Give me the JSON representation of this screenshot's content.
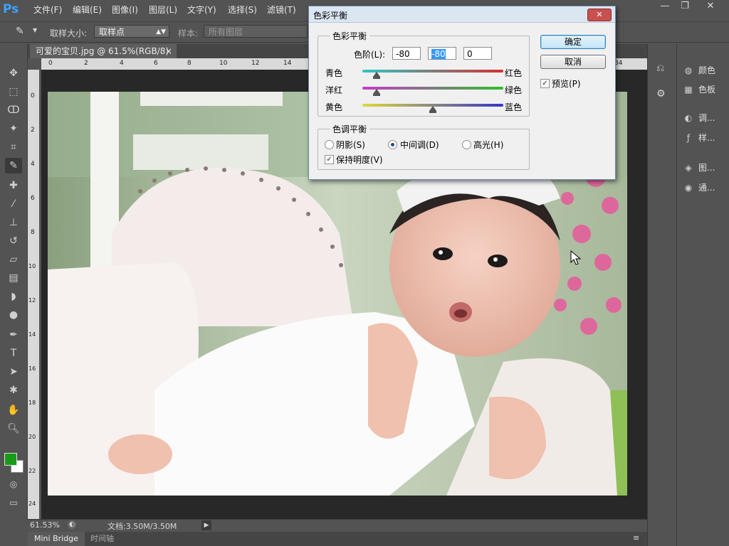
{
  "app": {
    "logo": "Ps"
  },
  "menu": [
    "文件(F)",
    "编辑(E)",
    "图像(I)",
    "图层(L)",
    "文字(Y)",
    "选择(S)",
    "滤镜(T)"
  ],
  "window_controls": {
    "minimize": "—",
    "restore": "❐",
    "close": "✕"
  },
  "options": {
    "sample_size_label": "取样大小:",
    "sample_size_value": "取样点",
    "sample_label": "样本:",
    "sample_value": "所有图层"
  },
  "document": {
    "tab_title": "可爱的宝贝.jpg @ 61.5%(RGB/8)",
    "tab_close": "×",
    "zoom": "61.53%",
    "doc_size": "文档:3.50M/3.50M"
  },
  "ruler_top_labels": [
    "0",
    "2",
    "4",
    "6",
    "8",
    "10",
    "12",
    "14"
  ],
  "ruler_left_labels": [
    "0",
    "2",
    "4",
    "6",
    "8",
    "10",
    "12",
    "14",
    "16",
    "18",
    "20",
    "22",
    "24"
  ],
  "bottom_tabs": {
    "mini_bridge": "Mini Bridge",
    "timeline": "时间轴"
  },
  "right_panel": {
    "items": [
      {
        "label": "颜色",
        "icon": "palette-icon"
      },
      {
        "label": "色板",
        "icon": "swatches-icon"
      },
      {
        "label": "调...",
        "icon": "adjustments-icon"
      },
      {
        "label": "样...",
        "icon": "styles-icon"
      },
      {
        "label": "图...",
        "icon": "layers-icon"
      },
      {
        "label": "通...",
        "icon": "channels-icon"
      }
    ]
  },
  "dialog": {
    "title": "色彩平衡",
    "close": "✕",
    "color_balance_group": "色彩平衡",
    "levels_label": "色阶(L):",
    "levels": [
      "-80",
      "-80",
      "0"
    ],
    "sliders": [
      {
        "left": "青色",
        "right": "红色",
        "value": -80
      },
      {
        "left": "洋红",
        "right": "绿色",
        "value": -80
      },
      {
        "left": "黄色",
        "right": "蓝色",
        "value": 0
      }
    ],
    "tone_balance_group": "色调平衡",
    "tones": {
      "shadows": "阴影(S)",
      "midtones": "中间调(D)",
      "highlights": "高光(H)"
    },
    "selected_tone": "midtones",
    "preserve_luminosity": "保持明度(V)",
    "preserve_checked": true,
    "ok": "确定",
    "cancel": "取消",
    "preview": "预览(P)",
    "preview_checked": true
  },
  "colors": {
    "foreground": "#1a9a1a",
    "background": "#ffffff",
    "accent": "#3399ff"
  }
}
